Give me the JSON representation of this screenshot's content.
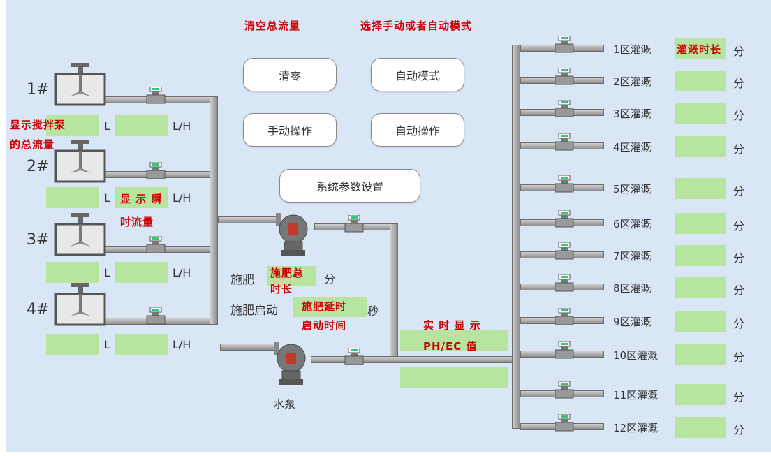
{
  "header": {
    "clear_total_flow": "清空总流量",
    "select_mode": "选择手动或者自动模式"
  },
  "buttons": {
    "clear": "清零",
    "auto_mode": "自动模式",
    "manual_op": "手动操作",
    "auto_op": "自动操作",
    "settings": "系统参数设置"
  },
  "tanks": [
    {
      "label": "1#",
      "unit_total": "L",
      "unit_rate": "L/H"
    },
    {
      "label": "2#",
      "unit_total": "L",
      "unit_rate": "L/H"
    },
    {
      "label": "3#",
      "unit_total": "L",
      "unit_rate": "L/H"
    },
    {
      "label": "4#",
      "unit_total": "L",
      "unit_rate": "L/H"
    }
  ],
  "annotations": {
    "stirrer_total_1": "显示搅拌泵",
    "stirrer_total_2": "的总流量",
    "instant_1": "显 示 瞬",
    "instant_2": "时流量",
    "fert_total_1": "施肥总",
    "fert_total_2": "时长",
    "fert_delay_1": "施肥延时",
    "fert_delay_2": "启动时间",
    "ph_1": "实 时 显 示",
    "ph_2": "PH/EC 值",
    "irrigation_duration": "灌溉时长"
  },
  "fertilizer": {
    "label": "施肥",
    "unit": "分",
    "start_label": "施肥启动",
    "start_unit": "秒"
  },
  "pump": {
    "label": "水泵"
  },
  "zones": [
    {
      "label": "1区灌溉",
      "unit": "分"
    },
    {
      "label": "2区灌溉",
      "unit": "分"
    },
    {
      "label": "3区灌溉",
      "unit": "分"
    },
    {
      "label": "4区灌溉",
      "unit": "分"
    },
    {
      "label": "5区灌溉",
      "unit": "分"
    },
    {
      "label": "6区灌溉",
      "unit": "分"
    },
    {
      "label": "7区灌溉",
      "unit": "分"
    },
    {
      "label": "8区灌溉",
      "unit": "分"
    },
    {
      "label": "9区灌溉",
      "unit": "分"
    },
    {
      "label": "10区灌溉",
      "unit": "分"
    },
    {
      "label": "11区灌溉",
      "unit": "分"
    },
    {
      "label": "12区灌溉",
      "unit": "分"
    }
  ],
  "colors": {
    "panel": "#d9e6f6",
    "display": "#b7e4a0",
    "annotation": "#cc0000",
    "pipe": "#a9a9a9"
  },
  "icons": [
    "stirring-tank-icon",
    "flow-meter-icon",
    "pump-icon"
  ]
}
